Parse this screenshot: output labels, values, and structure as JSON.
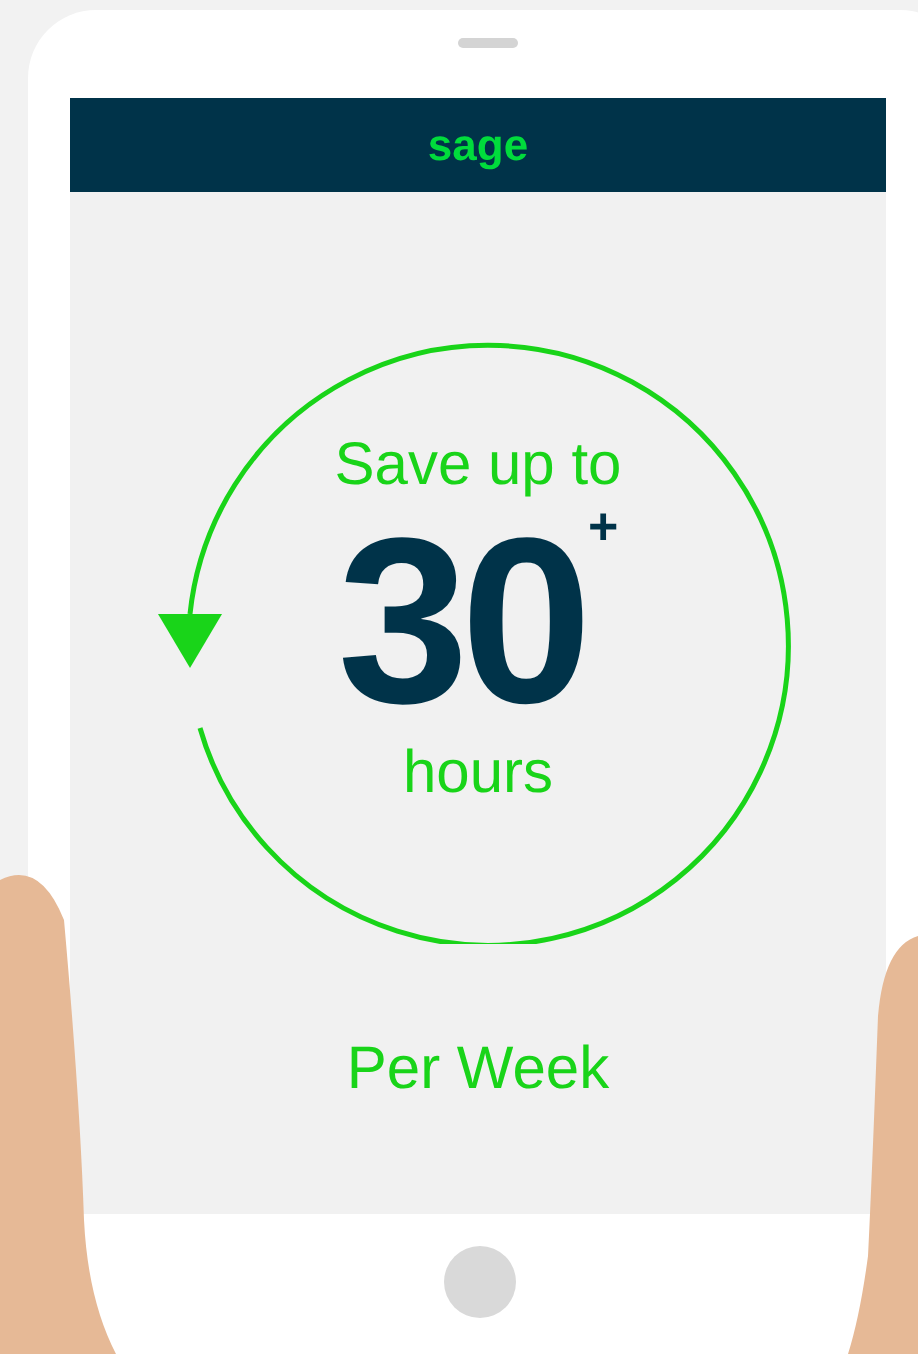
{
  "header": {
    "logo": "sage"
  },
  "promo": {
    "headline": "Save up to",
    "number": "30",
    "suffix": "+",
    "unit": "hours",
    "period": "Per Week"
  }
}
